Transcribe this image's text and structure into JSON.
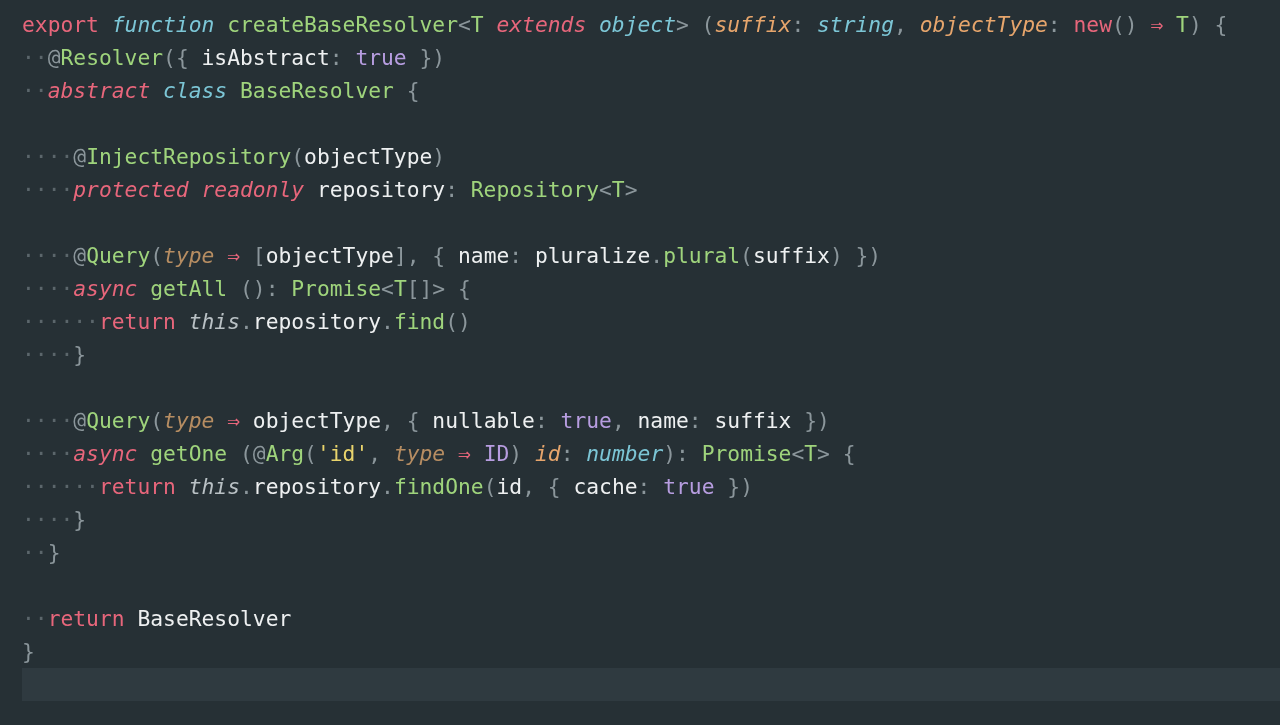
{
  "editor": {
    "current_line_highlighted": true,
    "lines": [
      {
        "tokens": [
          {
            "kind": "kw",
            "text": "export "
          },
          {
            "kind": "storage",
            "text": "function "
          },
          {
            "kind": "fn",
            "text": "createBaseResolver"
          },
          {
            "kind": "punct",
            "text": "<"
          },
          {
            "kind": "type",
            "text": "T "
          },
          {
            "kind": "kwi",
            "text": "extends "
          },
          {
            "kind": "storage",
            "text": "object"
          },
          {
            "kind": "punct",
            "text": "> ("
          },
          {
            "kind": "param",
            "text": "suffix"
          },
          {
            "kind": "punct",
            "text": ": "
          },
          {
            "kind": "storage",
            "text": "string"
          },
          {
            "kind": "punct",
            "text": ", "
          },
          {
            "kind": "param",
            "text": "objectType"
          },
          {
            "kind": "punct",
            "text": ": "
          },
          {
            "kind": "kw",
            "text": "new"
          },
          {
            "kind": "punct",
            "text": "() "
          },
          {
            "kind": "op",
            "text": "⇒ "
          },
          {
            "kind": "type",
            "text": "T"
          },
          {
            "kind": "punct",
            "text": ") {"
          }
        ]
      },
      {
        "indent": "··",
        "tokens": [
          {
            "kind": "punct",
            "text": "@"
          },
          {
            "kind": "fn",
            "text": "Resolver"
          },
          {
            "kind": "punct",
            "text": "({ "
          },
          {
            "kind": "plain",
            "text": "isAbstract"
          },
          {
            "kind": "punct",
            "text": ": "
          },
          {
            "kind": "const",
            "text": "true"
          },
          {
            "kind": "punct",
            "text": " })"
          }
        ]
      },
      {
        "indent": "··",
        "tokens": [
          {
            "kind": "kwi",
            "text": "abstract "
          },
          {
            "kind": "storage",
            "text": "class "
          },
          {
            "kind": "fn",
            "text": "BaseResolver"
          },
          {
            "kind": "punct",
            "text": " {"
          }
        ]
      },
      {
        "kind": "blank"
      },
      {
        "indent": "····",
        "tokens": [
          {
            "kind": "punct",
            "text": "@"
          },
          {
            "kind": "fn",
            "text": "InjectRepository"
          },
          {
            "kind": "punct",
            "text": "("
          },
          {
            "kind": "plain",
            "text": "objectType"
          },
          {
            "kind": "punct",
            "text": ")"
          }
        ]
      },
      {
        "indent": "····",
        "tokens": [
          {
            "kind": "kwi",
            "text": "protected readonly"
          },
          {
            "kind": "plain",
            "text": " repository"
          },
          {
            "kind": "punct",
            "text": ": "
          },
          {
            "kind": "type",
            "text": "Repository"
          },
          {
            "kind": "punct",
            "text": "<"
          },
          {
            "kind": "type",
            "text": "T"
          },
          {
            "kind": "punct",
            "text": ">"
          }
        ]
      },
      {
        "kind": "blank"
      },
      {
        "indent": "····",
        "tokens": [
          {
            "kind": "punct",
            "text": "@"
          },
          {
            "kind": "fn",
            "text": "Query"
          },
          {
            "kind": "punct",
            "text": "("
          },
          {
            "kind": "argi",
            "text": "type"
          },
          {
            "kind": "op",
            "text": " ⇒ "
          },
          {
            "kind": "punct",
            "text": "["
          },
          {
            "kind": "plain",
            "text": "objectType"
          },
          {
            "kind": "punct",
            "text": "], { "
          },
          {
            "kind": "plain",
            "text": "name"
          },
          {
            "kind": "punct",
            "text": ": "
          },
          {
            "kind": "plain",
            "text": "pluralize"
          },
          {
            "kind": "punct",
            "text": "."
          },
          {
            "kind": "fn",
            "text": "plural"
          },
          {
            "kind": "punct",
            "text": "("
          },
          {
            "kind": "plain",
            "text": "suffix"
          },
          {
            "kind": "punct",
            "text": ") })"
          }
        ]
      },
      {
        "indent": "····",
        "tokens": [
          {
            "kind": "kwi",
            "text": "async"
          },
          {
            "kind": "fn",
            "text": " getAll"
          },
          {
            "kind": "punct",
            "text": " (): "
          },
          {
            "kind": "type",
            "text": "Promise"
          },
          {
            "kind": "punct",
            "text": "<"
          },
          {
            "kind": "type",
            "text": "T"
          },
          {
            "kind": "punct",
            "text": "[]> {"
          }
        ]
      },
      {
        "indent": "······",
        "tokens": [
          {
            "kind": "kw",
            "text": "return "
          },
          {
            "kind": "this",
            "text": "this"
          },
          {
            "kind": "punct",
            "text": "."
          },
          {
            "kind": "plain",
            "text": "repository"
          },
          {
            "kind": "punct",
            "text": "."
          },
          {
            "kind": "fn",
            "text": "find"
          },
          {
            "kind": "punct",
            "text": "()"
          }
        ]
      },
      {
        "indent": "····",
        "tokens": [
          {
            "kind": "punct",
            "text": "}"
          }
        ]
      },
      {
        "kind": "blank"
      },
      {
        "indent": "····",
        "tokens": [
          {
            "kind": "punct",
            "text": "@"
          },
          {
            "kind": "fn",
            "text": "Query"
          },
          {
            "kind": "punct",
            "text": "("
          },
          {
            "kind": "argi",
            "text": "type"
          },
          {
            "kind": "op",
            "text": " ⇒ "
          },
          {
            "kind": "plain",
            "text": "objectType"
          },
          {
            "kind": "punct",
            "text": ", { "
          },
          {
            "kind": "plain",
            "text": "nullable"
          },
          {
            "kind": "punct",
            "text": ": "
          },
          {
            "kind": "const",
            "text": "true"
          },
          {
            "kind": "punct",
            "text": ", "
          },
          {
            "kind": "plain",
            "text": "name"
          },
          {
            "kind": "punct",
            "text": ": "
          },
          {
            "kind": "plain",
            "text": "suffix"
          },
          {
            "kind": "punct",
            "text": " })"
          }
        ]
      },
      {
        "indent": "····",
        "tokens": [
          {
            "kind": "kwi",
            "text": "async"
          },
          {
            "kind": "fn",
            "text": " getOne"
          },
          {
            "kind": "punct",
            "text": " (@"
          },
          {
            "kind": "fn",
            "text": "Arg"
          },
          {
            "kind": "punct",
            "text": "("
          },
          {
            "kind": "str",
            "text": "'id'"
          },
          {
            "kind": "punct",
            "text": ", "
          },
          {
            "kind": "argi",
            "text": "type"
          },
          {
            "kind": "op",
            "text": " ⇒ "
          },
          {
            "kind": "const",
            "text": "ID"
          },
          {
            "kind": "punct",
            "text": ") "
          },
          {
            "kind": "param",
            "text": "id"
          },
          {
            "kind": "punct",
            "text": ": "
          },
          {
            "kind": "storage",
            "text": "number"
          },
          {
            "kind": "punct",
            "text": "): "
          },
          {
            "kind": "type",
            "text": "Promise"
          },
          {
            "kind": "punct",
            "text": "<"
          },
          {
            "kind": "type",
            "text": "T"
          },
          {
            "kind": "punct",
            "text": "> {"
          }
        ]
      },
      {
        "indent": "······",
        "tokens": [
          {
            "kind": "kw",
            "text": "return "
          },
          {
            "kind": "this",
            "text": "this"
          },
          {
            "kind": "punct",
            "text": "."
          },
          {
            "kind": "plain",
            "text": "repository"
          },
          {
            "kind": "punct",
            "text": "."
          },
          {
            "kind": "fn",
            "text": "findOne"
          },
          {
            "kind": "punct",
            "text": "("
          },
          {
            "kind": "plain",
            "text": "id"
          },
          {
            "kind": "punct",
            "text": ", { "
          },
          {
            "kind": "plain",
            "text": "cache"
          },
          {
            "kind": "punct",
            "text": ": "
          },
          {
            "kind": "const",
            "text": "true"
          },
          {
            "kind": "punct",
            "text": " })"
          }
        ]
      },
      {
        "indent": "····",
        "tokens": [
          {
            "kind": "punct",
            "text": "}"
          }
        ]
      },
      {
        "indent": "··",
        "tokens": [
          {
            "kind": "punct",
            "text": "}"
          }
        ]
      },
      {
        "kind": "blank"
      },
      {
        "indent": "··",
        "tokens": [
          {
            "kind": "kw",
            "text": "return"
          },
          {
            "kind": "plain",
            "text": " BaseResolver"
          }
        ]
      },
      {
        "tokens": [
          {
            "kind": "punct",
            "text": "}"
          }
        ]
      }
    ]
  }
}
